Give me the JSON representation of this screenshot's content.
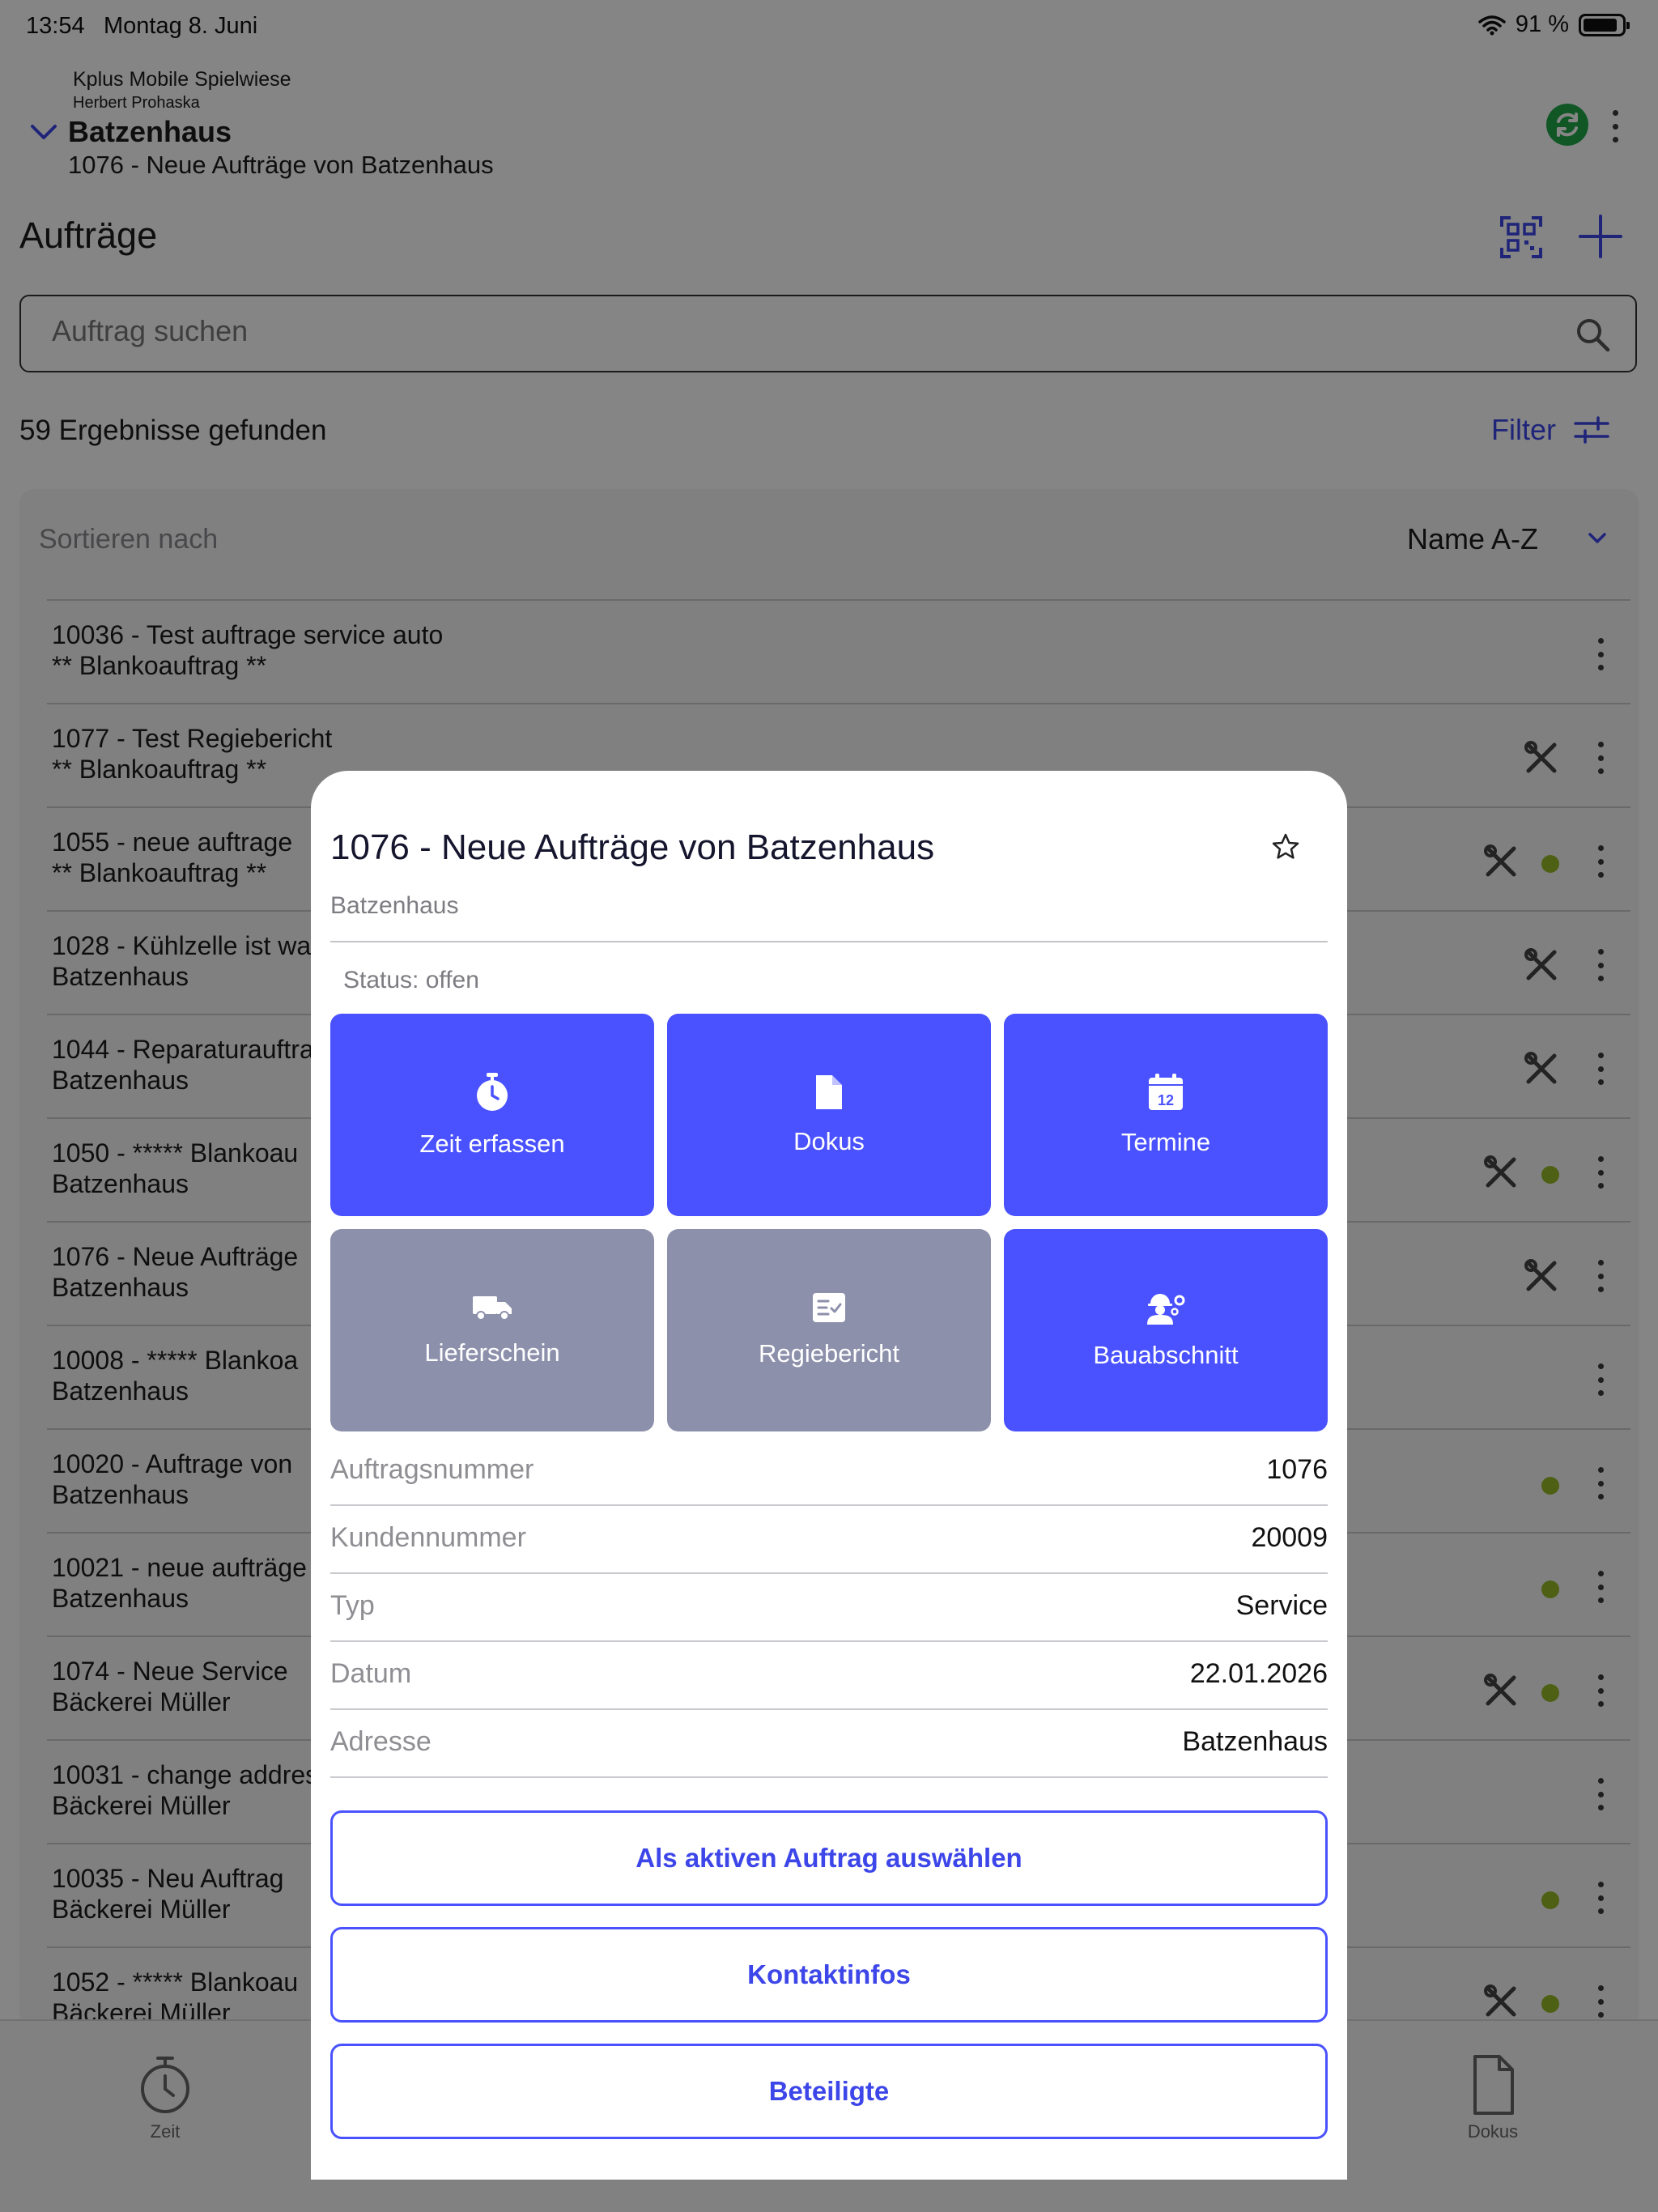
{
  "status_bar": {
    "time": "13:54",
    "date": "Montag 8. Juni",
    "battery": "91 %"
  },
  "header": {
    "org": "Kplus Mobile Spielwiese",
    "user": "Herbert Prohaska",
    "client": "Batzenhaus",
    "active_order": "1076 - Neue Aufträge von Batzenhaus"
  },
  "page": {
    "title": "Aufträge",
    "search_placeholder": "Auftrag suchen",
    "results": "59 Ergebnisse gefunden",
    "filter": "Filter",
    "sort_label": "Sortieren nach",
    "sort_value": "Name A-Z"
  },
  "orders": [
    {
      "l1": "10036 - Test auftrage service auto",
      "l2": "** Blankoauftrag **"
    },
    {
      "l1": "1077 - Test Regiebericht",
      "l2": "** Blankoauftrag **"
    },
    {
      "l1": "1055 - neue auftrage",
      "l2": "** Blankoauftrag **"
    },
    {
      "l1": "1028 - Kühlzelle ist wa",
      "l2": "Batzenhaus"
    },
    {
      "l1": "1044 - Reparaturauftra",
      "l2": "Batzenhaus"
    },
    {
      "l1": "1050 - ***** Blankoau",
      "l2": "Batzenhaus"
    },
    {
      "l1": "1076 - Neue Aufträge",
      "l2": "Batzenhaus"
    },
    {
      "l1": "10008 - ***** Blankoa",
      "l2": "Batzenhaus"
    },
    {
      "l1": "10020 - Auftrage von",
      "l2": "Batzenhaus"
    },
    {
      "l1": "10021 - neue aufträge",
      "l2": "Batzenhaus"
    },
    {
      "l1": "1074 -  Neue Service",
      "l2": "Bäckerei Müller"
    },
    {
      "l1": "10031 - change addres",
      "l2": "Bäckerei Müller"
    },
    {
      "l1": "10035 - Neu Auftrag",
      "l2": "Bäckerei Müller"
    },
    {
      "l1": "1052 - ***** Blankoau",
      "l2": "Bäckerei Müller"
    }
  ],
  "tabbar": {
    "left": "Zeit",
    "right": "Dokus"
  },
  "modal": {
    "title": "1076 - Neue Aufträge von Batzenhaus",
    "subtitle": "Batzenhaus",
    "status": "Status: offen",
    "tiles": {
      "zeit": "Zeit erfassen",
      "dokus": "Dokus",
      "termine": "Termine",
      "termine_day": "12",
      "lieferschein": "Lieferschein",
      "regiebericht": "Regiebericht",
      "bauabschnitt": "Bauabschnitt"
    },
    "details": {
      "auftragsnummer_label": "Auftragsnummer",
      "auftragsnummer": "1076",
      "kundennummer_label": "Kundennummer",
      "kundennummer": "20009",
      "typ_label": "Typ",
      "typ": "Service",
      "datum_label": "Datum",
      "datum": "22.01.2026",
      "adresse_label": "Adresse",
      "adresse": "Batzenhaus"
    },
    "buttons": {
      "activate": "Als aktiven Auftrag auswählen",
      "contact": "Kontaktinfos",
      "participants": "Beteiligte"
    }
  },
  "colors": {
    "accent": "#4a52ff",
    "disabled": "#8c90ab",
    "status_dot": "#95b928",
    "sync": "#22a84a"
  }
}
